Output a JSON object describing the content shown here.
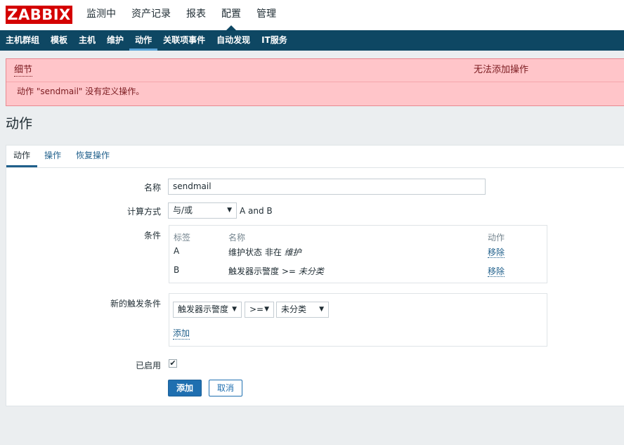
{
  "logo": "ZABBIX",
  "main_menu": [
    {
      "label": "监测中"
    },
    {
      "label": "资产记录"
    },
    {
      "label": "报表"
    },
    {
      "label": "配置"
    },
    {
      "label": "管理"
    }
  ],
  "active_main_menu": "配置",
  "sub_nav": [
    {
      "label": "主机群组"
    },
    {
      "label": "模板"
    },
    {
      "label": "主机"
    },
    {
      "label": "维护"
    },
    {
      "label": "动作"
    },
    {
      "label": "关联项事件"
    },
    {
      "label": "自动发现"
    },
    {
      "label": "IT服务"
    }
  ],
  "active_sub_nav": "动作",
  "message": {
    "details_label": "细节",
    "title": "无法添加操作",
    "text": "动作 \"sendmail\" 没有定义操作。"
  },
  "page_title": "动作",
  "tabs": [
    {
      "label": "动作"
    },
    {
      "label": "操作"
    },
    {
      "label": "恢复操作"
    }
  ],
  "active_tab": "动作",
  "form": {
    "name_label": "名称",
    "name_value": "sendmail",
    "calc_label": "计算方式",
    "calc_value": "与/或",
    "calc_expression": "A and B",
    "conditions_label": "条件",
    "conditions_headers": {
      "tag": "标签",
      "name": "名称",
      "action": "动作"
    },
    "conditions": [
      {
        "tag": "A",
        "name_prefix": "维护状态 非在",
        "name_value": "维护",
        "action": "移除"
      },
      {
        "tag": "B",
        "name_prefix": "触发器示警度 >=",
        "name_value": "未分类",
        "action": "移除"
      }
    ],
    "new_condition_label": "新的触发条件",
    "new_condition_type": "触发器示警度",
    "new_condition_operator": ">=",
    "new_condition_value": "未分类",
    "new_condition_add": "添加",
    "enabled_label": "已启用",
    "enabled": true,
    "add_button": "添加",
    "cancel_button": "取消"
  }
}
